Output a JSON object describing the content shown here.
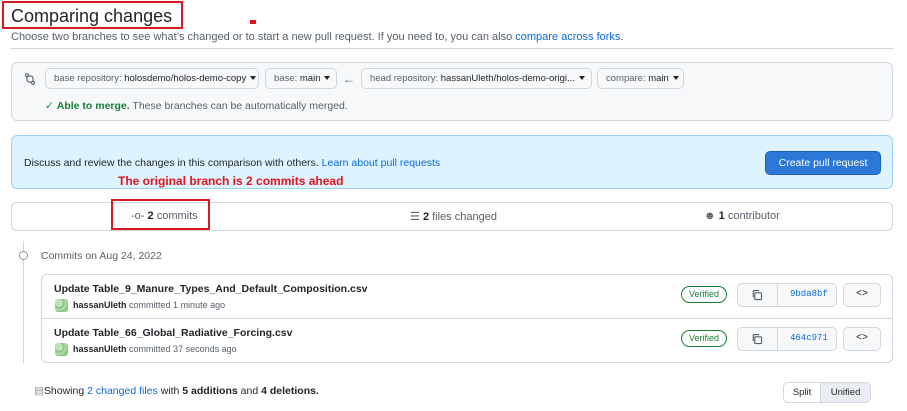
{
  "header": {
    "title": "Comparing changes",
    "subtitle_prefix": "Choose two branches to see what’s changed or to start a new pull request. If you need to, you can also",
    "subtitle_link": "compare across forks",
    "subtitle_suffix": "."
  },
  "range": {
    "base_repository_label": "base repository:",
    "base_repository_value": "holosdemo/holos-demo-copy",
    "base_label": "base:",
    "base_value": "main",
    "head_repository_label": "head repository:",
    "head_repository_value": "hassanUleth/holos-demo-origi...",
    "compare_label": "compare:",
    "compare_value": "main",
    "merge_status": "Able to merge.",
    "merge_detail": "These branches can be automatically merged."
  },
  "flash": {
    "text": "Discuss and review the changes in this comparison with others.",
    "link": "Learn about pull requests",
    "button": "Create pull request"
  },
  "annotation": "The original branch is 2 commits ahead",
  "tabs": {
    "commits_count": "2",
    "commits_label": "commits",
    "files_count": "2",
    "files_label": "files changed",
    "contributors_count": "1",
    "contributors_label": "contributor"
  },
  "commits_date": "Commits on Aug 24, 2022",
  "commits": [
    {
      "message": "Update Table_9_Manure_Types_And_Default_Composition.csv",
      "author": "hassanUleth",
      "meta": "committed 1 minute ago",
      "badge": "Verified",
      "sha": "9bda8bf"
    },
    {
      "message": "Update Table_66_Global_Radiative_Forcing.csv",
      "author": "hassanUleth",
      "meta": "committed 37 seconds ago",
      "badge": "Verified",
      "sha": "464c971"
    }
  ],
  "summary": {
    "prefix": "Showing",
    "files_link": "2 changed files",
    "with": "with",
    "additions": "5 additions",
    "and": "and",
    "deletions": "4 deletions.",
    "split": "Split",
    "unified": "Unified"
  },
  "colors": {
    "accent": "#0969da",
    "primary_button": "#2b78d8",
    "success": "#1a7f37",
    "annotation": "#e5121b"
  }
}
